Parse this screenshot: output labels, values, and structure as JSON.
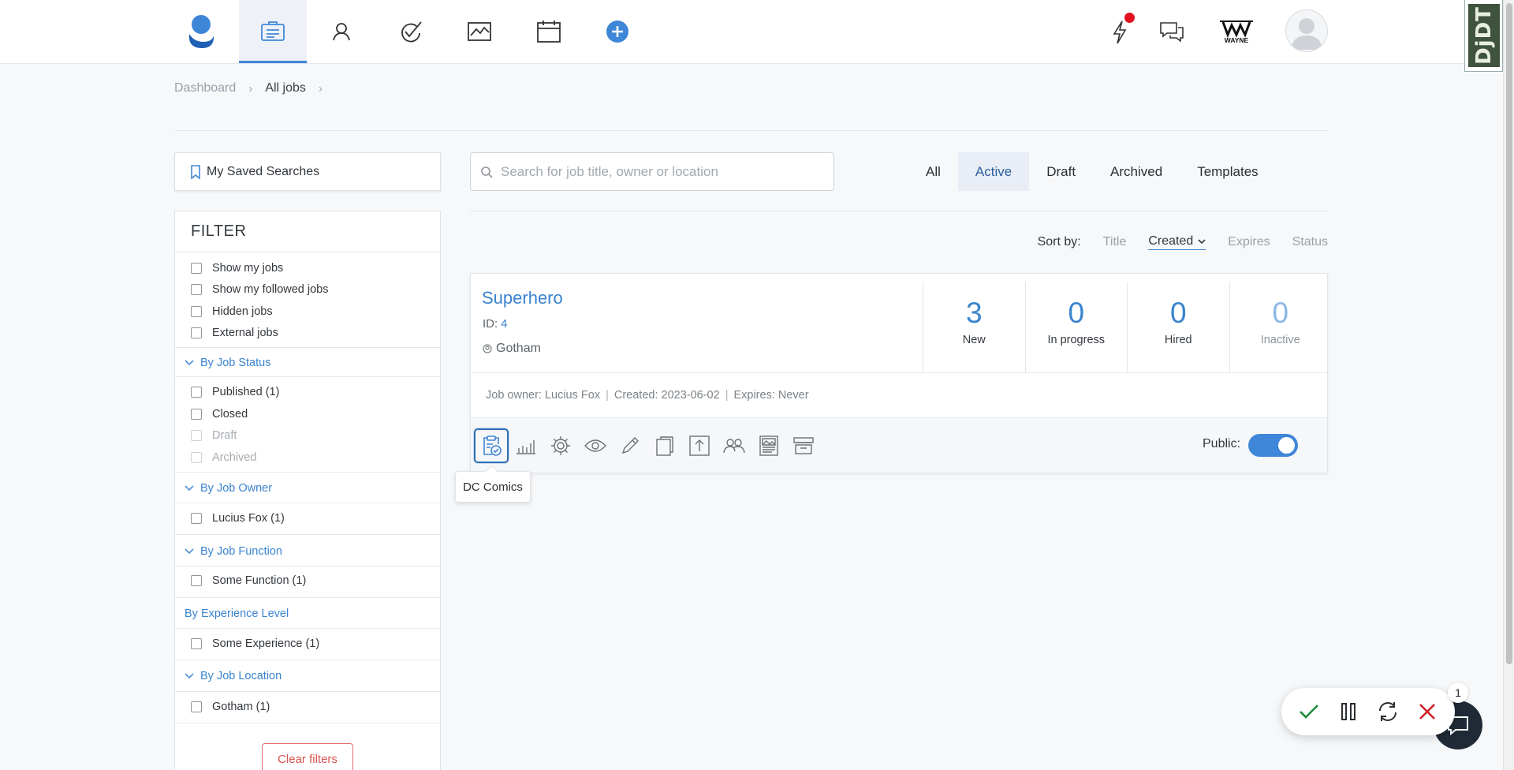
{
  "header": {
    "nav": [
      {
        "name": "logo",
        "icon": "app-logo"
      },
      {
        "name": "jobs",
        "icon": "briefcase-icon",
        "active": true
      },
      {
        "name": "candidates",
        "icon": "person-icon"
      },
      {
        "name": "tasks",
        "icon": "checkmark-icon"
      },
      {
        "name": "reports",
        "icon": "chart-icon"
      },
      {
        "name": "calendar",
        "icon": "calendar-icon"
      },
      {
        "name": "create",
        "icon": "plus-circle-icon"
      }
    ],
    "company_logo_text": "WAYNE",
    "djdt_label": "DjDT"
  },
  "breadcrumb": {
    "items": [
      "Dashboard",
      "All jobs"
    ],
    "separator": "›"
  },
  "sidebar": {
    "saved_searches_label": "My Saved Searches",
    "filter_title": "FILTER",
    "general": [
      "Show my jobs",
      "Show my followed jobs",
      "Hidden jobs",
      "External jobs"
    ],
    "sections": [
      {
        "title": "By Job Status",
        "items": [
          "Published (1)",
          "Closed",
          "Draft",
          "Archived"
        ]
      },
      {
        "title": "By Job Owner",
        "items": [
          "Lucius Fox (1)"
        ]
      },
      {
        "title": "By Job Function",
        "items": [
          "Some Function (1)"
        ]
      },
      {
        "title": "By Experience Level",
        "items": [
          "Some Experience (1)"
        ]
      },
      {
        "title": "By Job Location",
        "items": [
          "Gotham (1)"
        ]
      }
    ],
    "clear_label": "Clear filters"
  },
  "search": {
    "placeholder": "Search for job title, owner or location",
    "value": ""
  },
  "tabs": [
    "All",
    "Active",
    "Draft",
    "Archived",
    "Templates"
  ],
  "active_tab": "Active",
  "sort": {
    "label": "Sort by:",
    "options": [
      "Title",
      "Created",
      "Expires",
      "Status"
    ],
    "selected": "Created"
  },
  "job": {
    "title": "Superhero",
    "id_label": "ID:",
    "id": "4",
    "location": "Gotham",
    "stats": [
      {
        "value": "3",
        "label": "New"
      },
      {
        "value": "0",
        "label": "In progress"
      },
      {
        "value": "0",
        "label": "Hired"
      },
      {
        "value": "0",
        "label": "Inactive"
      }
    ],
    "meta": [
      "Job owner: Lucius Fox",
      "Created: 2023-06-02",
      "Expires: Never"
    ],
    "meta_divider": "|",
    "public_label": "Public:",
    "public": true
  },
  "tooltip": "DC Comics",
  "floatbar": {
    "count": "1"
  },
  "colors": {
    "accent": "#3e86d8",
    "link": "#3a84cf",
    "danger": "#d9534f",
    "success": "#1e8c3a"
  }
}
